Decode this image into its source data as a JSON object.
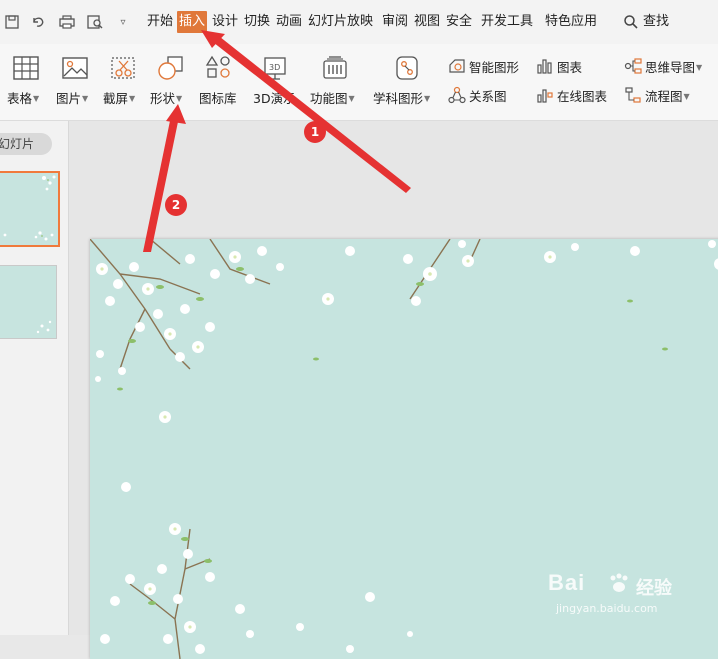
{
  "menubar": {
    "quick_access_icons": [
      "save-icon",
      "undo-icon",
      "print-icon",
      "print-preview-icon",
      "customize-dropdown-icon"
    ],
    "tabs": [
      {
        "label": "开始",
        "active": false
      },
      {
        "label": "插入",
        "active": true
      },
      {
        "label": "设计",
        "active": false
      },
      {
        "label": "切换",
        "active": false
      },
      {
        "label": "动画",
        "active": false
      },
      {
        "label": "幻灯片放映",
        "active": false
      },
      {
        "label": "审阅",
        "active": false
      },
      {
        "label": "视图",
        "active": false
      },
      {
        "label": "安全",
        "active": false
      },
      {
        "label": "开发工具",
        "active": false
      },
      {
        "label": "特色应用",
        "active": false
      }
    ],
    "search_label": "查找"
  },
  "ribbon": {
    "buttons": [
      {
        "label": "表格",
        "icon": "table-icon",
        "dropdown": true
      },
      {
        "label": "图片",
        "icon": "picture-icon",
        "dropdown": true
      },
      {
        "label": "截屏",
        "icon": "screenshot-icon",
        "dropdown": true
      },
      {
        "label": "形状",
        "icon": "shapes-icon",
        "dropdown": true
      },
      {
        "label": "图标库",
        "icon": "icon-library-icon",
        "dropdown": false
      },
      {
        "label": "3D演示",
        "icon": "3d-demo-icon",
        "dropdown": false
      },
      {
        "label": "功能图",
        "icon": "function-chart-icon",
        "dropdown": true
      },
      {
        "label": "学科图形",
        "icon": "subject-graphics-icon",
        "dropdown": true
      }
    ],
    "small_buttons": [
      {
        "label": "智能图形",
        "icon": "smart-art-icon",
        "dropdown": false
      },
      {
        "label": "图表",
        "icon": "chart-icon",
        "dropdown": false
      },
      {
        "label": "思维导图",
        "icon": "mind-map-icon",
        "dropdown": true
      },
      {
        "label": "关系图",
        "icon": "relation-chart-icon",
        "dropdown": false
      },
      {
        "label": "在线图表",
        "icon": "online-chart-icon",
        "dropdown": false
      },
      {
        "label": "流程图",
        "icon": "flowchart-icon",
        "dropdown": true
      }
    ]
  },
  "sidebar": {
    "tab_label": "幻灯片",
    "slide_count": 2,
    "selected_slide": 1
  },
  "annotations": {
    "badge_1": "1",
    "badge_2": "2",
    "color": "#e53232"
  },
  "watermark": {
    "main": "Bai",
    "cn": "经验",
    "url": "jingyan.baidu.com"
  },
  "colors": {
    "accent": "#e0783a",
    "slide_background": "#c6e4df",
    "thumbnail_selection": "#f07a3c"
  }
}
